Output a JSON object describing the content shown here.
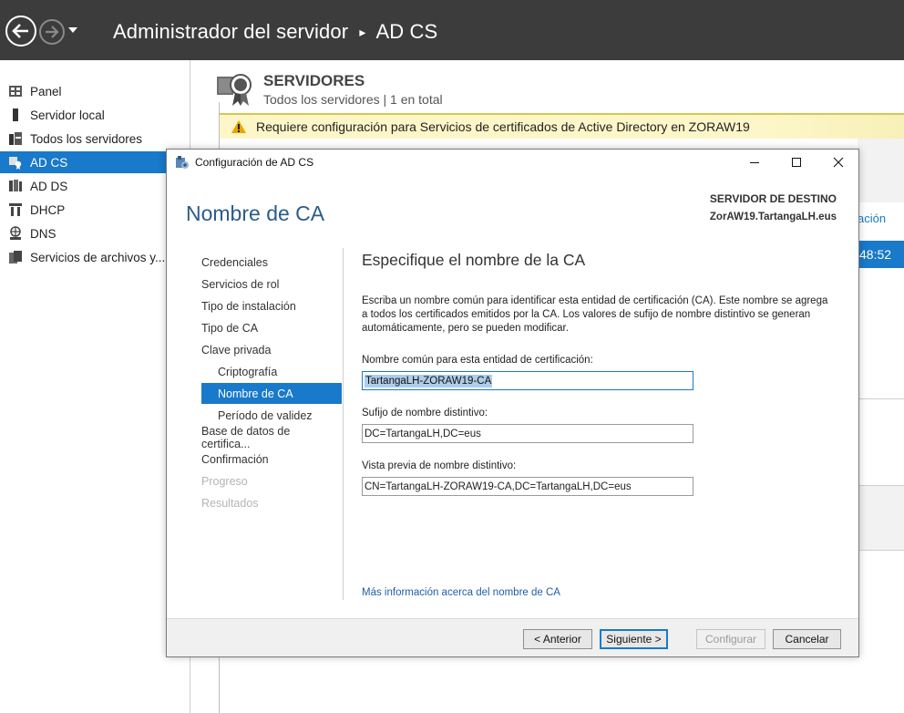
{
  "window": {
    "title": "Administrador del servidor",
    "breadcrumb_sep": "▸",
    "breadcrumb_current": "AD CS"
  },
  "leftnav": {
    "items": [
      {
        "label": "Panel",
        "icon": "dashboard-icon"
      },
      {
        "label": "Servidor local",
        "icon": "server-icon"
      },
      {
        "label": "Todos los servidores",
        "icon": "servers-icon"
      },
      {
        "label": "AD CS",
        "icon": "certificate-icon",
        "active": true
      },
      {
        "label": "AD DS",
        "icon": "directory-icon"
      },
      {
        "label": "DHCP",
        "icon": "dhcp-icon"
      },
      {
        "label": "DNS",
        "icon": "dns-icon"
      },
      {
        "label": "Servicios de archivos y...",
        "icon": "file-services-icon"
      }
    ]
  },
  "servers": {
    "title": "SERVIDORES",
    "subtitle": "Todos los servidores | 1 en total"
  },
  "warning": {
    "text": "Requiere configuración para Servicios de certificados de Active Directory en ZORAW19"
  },
  "background_fragments": {
    "tab_fragment": "ación",
    "time_fragment": "48:52"
  },
  "dialog": {
    "title": "Configuración de AD CS",
    "heading": "Nombre de CA",
    "dest_label": "SERVIDOR DE DESTINO",
    "dest_value": "ZorAW19.TartangaLH.eus",
    "steps": [
      {
        "label": "Credenciales",
        "sub": false,
        "state": "normal"
      },
      {
        "label": "Servicios de rol",
        "sub": false,
        "state": "normal"
      },
      {
        "label": "Tipo de instalación",
        "sub": false,
        "state": "normal"
      },
      {
        "label": "Tipo de CA",
        "sub": false,
        "state": "normal"
      },
      {
        "label": "Clave privada",
        "sub": false,
        "state": "normal"
      },
      {
        "label": "Criptografía",
        "sub": true,
        "state": "normal"
      },
      {
        "label": "Nombre de CA",
        "sub": true,
        "state": "active"
      },
      {
        "label": "Período de validez",
        "sub": true,
        "state": "normal"
      },
      {
        "label": "Base de datos de certifica...",
        "sub": false,
        "state": "normal"
      },
      {
        "label": "Confirmación",
        "sub": false,
        "state": "normal"
      },
      {
        "label": "Progreso",
        "sub": false,
        "state": "disabled"
      },
      {
        "label": "Resultados",
        "sub": false,
        "state": "disabled"
      }
    ],
    "content_title": "Especifique el nombre de la CA",
    "description": "Escriba un nombre común para identificar esta entidad de certificación (CA). Este nombre se agrega a todos los certificados emitidos por la CA. Los valores de sufijo de nombre distintivo se generan automáticamente, pero se pueden modificar.",
    "fields": {
      "common_name_label": "Nombre común para esta entidad de certificación:",
      "common_name_value": "TartangaLH-ZORAW19-CA",
      "suffix_label": "Sufijo de nombre distintivo:",
      "suffix_value": "DC=TartangaLH,DC=eus",
      "preview_label": "Vista previa de nombre distintivo:",
      "preview_value": "CN=TartangaLH-ZORAW19-CA,DC=TartangaLH,DC=eus"
    },
    "more_link": "Más información acerca del nombre de CA",
    "buttons": {
      "back": "< Anterior",
      "next": "Siguiente >",
      "configure": "Configurar",
      "cancel": "Cancelar"
    }
  }
}
